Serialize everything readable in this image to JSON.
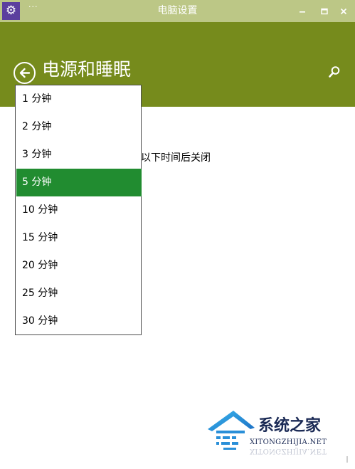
{
  "window": {
    "title": "电脑设置",
    "app_icon": "gear-icon",
    "menu_icon": "ellipsis-icon",
    "minimize_icon": "minimize-icon",
    "maximize_icon": "maximize-icon",
    "close_icon": "close-icon"
  },
  "header": {
    "title": "电源和睡眠",
    "back_icon": "back-arrow-icon",
    "search_icon": "search-icon",
    "color": "#768b1c"
  },
  "main": {
    "setting_label_visible": "以下时间后关闭"
  },
  "dropdown": {
    "selected_value": "5 分钟",
    "options": [
      "1 分钟",
      "2 分钟",
      "3 分钟",
      "5 分钟",
      "10 分钟",
      "15 分钟",
      "20 分钟",
      "25 分钟",
      "30 分钟"
    ],
    "selected_color": "#218c30"
  },
  "watermark": {
    "title": "系统之家",
    "url": "XITONGZHIJIA.NET",
    "logo_icon": "house-logo-icon"
  },
  "colors": {
    "titlebar": "#bcc786",
    "header": "#768b1c",
    "accent_selected": "#218c30",
    "app_icon_bg": "#5b3f9e"
  }
}
